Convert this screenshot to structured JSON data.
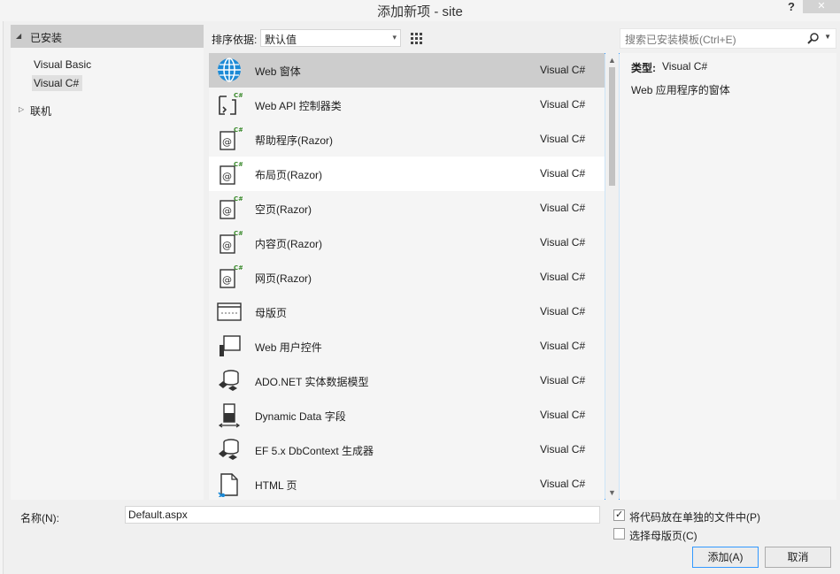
{
  "window": {
    "title": "添加新项 - site",
    "help": "?",
    "close": "✕"
  },
  "tree": {
    "header": "已安装",
    "items": [
      "Visual Basic",
      "Visual C#"
    ],
    "online": "联机"
  },
  "toolbar": {
    "sort_label": "排序依据:",
    "sort_value": "默认值"
  },
  "items": [
    {
      "name": "Web 窗体",
      "type": "Visual C#",
      "icon": "web-form-globe-icon"
    },
    {
      "name": "Web API 控制器类",
      "type": "Visual C#",
      "icon": "webapi-controller-icon"
    },
    {
      "name": "帮助程序(Razor)",
      "type": "Visual C#",
      "icon": "razor-file-icon"
    },
    {
      "name": "布局页(Razor)",
      "type": "Visual C#",
      "icon": "razor-file-icon"
    },
    {
      "name": "空页(Razor)",
      "type": "Visual C#",
      "icon": "razor-file-icon"
    },
    {
      "name": "内容页(Razor)",
      "type": "Visual C#",
      "icon": "razor-file-icon"
    },
    {
      "name": "网页(Razor)",
      "type": "Visual C#",
      "icon": "razor-file-icon"
    },
    {
      "name": "母版页",
      "type": "Visual C#",
      "icon": "master-page-icon"
    },
    {
      "name": "Web 用户控件",
      "type": "Visual C#",
      "icon": "user-control-icon"
    },
    {
      "name": "ADO.NET 实体数据模型",
      "type": "Visual C#",
      "icon": "entity-model-icon"
    },
    {
      "name": "Dynamic Data 字段",
      "type": "Visual C#",
      "icon": "dynamic-data-icon"
    },
    {
      "name": "EF 5.x DbContext 生成器",
      "type": "Visual C#",
      "icon": "entity-model-icon"
    },
    {
      "name": "HTML 页",
      "type": "Visual C#",
      "icon": "html-page-icon"
    }
  ],
  "search": {
    "placeholder": "搜索已安装模板(Ctrl+E)"
  },
  "info": {
    "type_label": "类型:",
    "type_value": "Visual C#",
    "description": "Web 应用程序的窗体"
  },
  "bottom": {
    "name_label": "名称(N):",
    "name_value": "Default.aspx",
    "check1": "将代码放在单独的文件中(P)",
    "check2": "选择母版页(C)",
    "add": "添加(A)",
    "cancel": "取消"
  },
  "colors": {
    "accent": "#3399ff",
    "selected_row": "#cdcdcd",
    "globe": "#1c8ad6",
    "csharp_green": "#3a8a2c"
  }
}
